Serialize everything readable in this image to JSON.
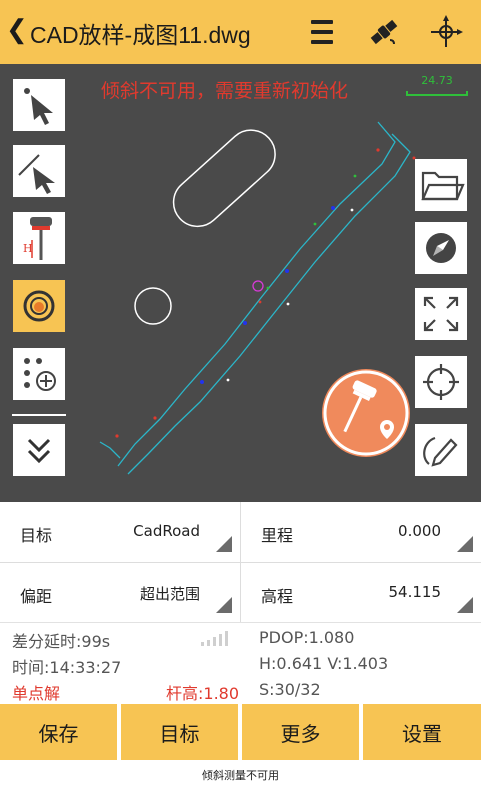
{
  "header": {
    "back_icon": "chevron-left-icon",
    "title": "CAD放样-成图11.dwg",
    "icons": [
      "menu-icon",
      "satellite-icon",
      "crosshair-arrows-icon"
    ]
  },
  "map": {
    "warning": "倾斜不可用，需要重新初始化",
    "scale_label": "24.73",
    "left_tools": [
      "select-arrow-icon",
      "line-select-icon",
      "rover-pole-icon",
      "target-dot-icon",
      "points-add-icon",
      "double-chevron-down-icon"
    ],
    "right_tools": [
      "folder-icon",
      "compass-icon",
      "expand-icon",
      "locate-icon",
      "edit-icon"
    ],
    "fab_icon": "stakeout-pole-icon"
  },
  "info": {
    "target_label": "目标",
    "target_value": "CadRoad",
    "mileage_label": "里程",
    "mileage_value": "0.000",
    "offset_label": "偏距",
    "offset_value": "超出范围",
    "elevation_label": "高程",
    "elevation_value": "54.115"
  },
  "status": {
    "diff_delay": "差分延时:99s",
    "time": "时间:14:33:27",
    "solution": "单点解",
    "pole_height": "杆高:1.80",
    "pdop": "PDOP:1.080",
    "hv": "H:0.641  V:1.403",
    "sats": "S:30/32"
  },
  "buttons": [
    "保存",
    "目标",
    "更多",
    "设置"
  ],
  "toast": "倾斜测量不可用",
  "colors": {
    "accent": "#f7c453",
    "map_bg": "#4a4a4a",
    "warning": "#e03a2e",
    "road": "#2bb6c9",
    "fab": "#f08a5c"
  }
}
